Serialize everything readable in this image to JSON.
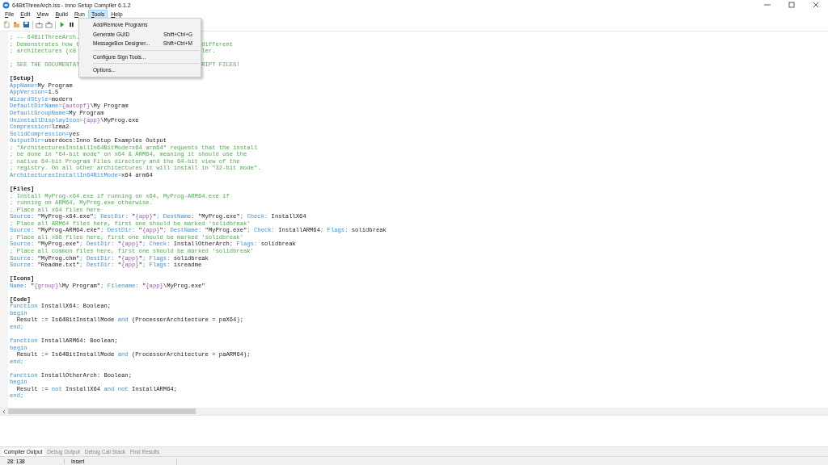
{
  "window": {
    "title": "64BitThreeArch.iss - Inno Setup Compiler 6.1.2"
  },
  "menu_bar": [
    {
      "label": "File",
      "selected": false
    },
    {
      "label": "Edit",
      "selected": false
    },
    {
      "label": "View",
      "selected": false
    },
    {
      "label": "Build",
      "selected": false
    },
    {
      "label": "Run",
      "selected": false
    },
    {
      "label": "Tools",
      "selected": true
    },
    {
      "label": "Help",
      "selected": false
    }
  ],
  "tools_menu": [
    {
      "kind": "item",
      "label": "Add/Remove Programs"
    },
    {
      "kind": "item",
      "label": "Generate GUID",
      "shortcut": "Shift+Ctrl+G"
    },
    {
      "kind": "item",
      "label": "MessageBox Designer...",
      "shortcut": "Shift+Ctrl+M"
    },
    {
      "kind": "separator"
    },
    {
      "kind": "item",
      "label": "Configure Sign Tools..."
    },
    {
      "kind": "separator"
    },
    {
      "kind": "item",
      "label": "Options..."
    }
  ],
  "editor": {
    "lines": [
      {
        "tokens": [
          {
            "kind": "comment",
            "text": "; -- 64BitThreeArch."
          }
        ]
      },
      {
        "tokens": [
          {
            "kind": "comment",
            "text": "; Demonstrates how t"
          }
        ],
        "tail": [
          {
            "kind": "comment",
            "text": "different"
          }
        ]
      },
      {
        "tokens": [
          {
            "kind": "comment",
            "text": "; architectures (x8"
          }
        ],
        "tail": [
          {
            "kind": "comment",
            "text": "ler."
          }
        ]
      },
      {
        "kind": "blank"
      },
      {
        "tokens": [
          {
            "kind": "comment",
            "text": "; SEE THE DOCUMENTAT"
          }
        ],
        "tail": [
          {
            "kind": "comment",
            "text": "RIPT FILES!"
          }
        ]
      },
      {
        "kind": "blank"
      },
      {
        "tokens": [
          {
            "kind": "section",
            "text": "[Setup]"
          }
        ]
      },
      {
        "tokens": [
          {
            "kind": "key",
            "text": "AppName="
          },
          {
            "kind": "text",
            "text": "My Program"
          }
        ]
      },
      {
        "tokens": [
          {
            "kind": "key",
            "text": "AppVersion="
          },
          {
            "kind": "text",
            "text": "1.5"
          }
        ]
      },
      {
        "tokens": [
          {
            "kind": "key",
            "text": "WizardStyle="
          },
          {
            "kind": "text",
            "text": "modern"
          }
        ]
      },
      {
        "tokens": [
          {
            "kind": "key",
            "text": "DefaultDirName="
          },
          {
            "kind": "const",
            "text": "{autopf}"
          },
          {
            "kind": "text",
            "text": "\\My Program"
          }
        ]
      },
      {
        "tokens": [
          {
            "kind": "key",
            "text": "DefaultGroupName="
          },
          {
            "kind": "text",
            "text": "My Program"
          }
        ]
      },
      {
        "tokens": [
          {
            "kind": "key",
            "text": "UninstallDisplayIcon="
          },
          {
            "kind": "const",
            "text": "{app}"
          },
          {
            "kind": "text",
            "text": "\\MyProg.exe"
          }
        ]
      },
      {
        "tokens": [
          {
            "kind": "key",
            "text": "Compression="
          },
          {
            "kind": "text",
            "text": "lzma2"
          }
        ]
      },
      {
        "tokens": [
          {
            "kind": "key",
            "text": "SolidCompression="
          },
          {
            "kind": "text",
            "text": "yes"
          }
        ]
      },
      {
        "tokens": [
          {
            "kind": "key",
            "text": "OutputDir="
          },
          {
            "kind": "text",
            "text": "userdocs:Inno Setup Examples Output"
          }
        ]
      },
      {
        "tokens": [
          {
            "kind": "comment",
            "text": "; \"ArchitecturesInstallIn64BitMode=x64 arm64\" requests that the install"
          }
        ]
      },
      {
        "tokens": [
          {
            "kind": "comment",
            "text": "; be done in \"64-bit mode\" on x64 & ARM64, meaning it should use the"
          }
        ]
      },
      {
        "tokens": [
          {
            "kind": "comment",
            "text": "; native 64-bit Program Files directory and the 64-bit view of the"
          }
        ]
      },
      {
        "tokens": [
          {
            "kind": "comment",
            "text": "; registry. On all other architectures it will install in \"32-bit mode\"."
          }
        ]
      },
      {
        "tokens": [
          {
            "kind": "key",
            "text": "ArchitecturesInstallIn64BitMode="
          },
          {
            "kind": "text",
            "text": "x64 arm64"
          }
        ]
      },
      {
        "kind": "blank"
      },
      {
        "tokens": [
          {
            "kind": "section",
            "text": "[Files]"
          }
        ]
      },
      {
        "tokens": [
          {
            "kind": "comment",
            "text": "; Install MyProg-x64.exe if running on x64, MyProg-ARM64.exe if"
          }
        ]
      },
      {
        "tokens": [
          {
            "kind": "comment",
            "text": "; running on ARM64, MyProg.exe otherwise."
          }
        ]
      },
      {
        "tokens": [
          {
            "kind": "comment",
            "text": "; Place all x64 files here"
          }
        ]
      },
      {
        "tokens": [
          {
            "kind": "key",
            "text": "Source: "
          },
          {
            "kind": "text",
            "text": "\"MyProg-x64.exe\""
          },
          {
            "kind": "key",
            "text": "; DestDir: "
          },
          {
            "kind": "text",
            "text": "\""
          },
          {
            "kind": "const",
            "text": "{app}"
          },
          {
            "kind": "text",
            "text": "\""
          },
          {
            "kind": "key",
            "text": "; DestName: "
          },
          {
            "kind": "text",
            "text": "\"MyProg.exe\""
          },
          {
            "kind": "key",
            "text": "; Check: "
          },
          {
            "kind": "text",
            "text": "InstallX64"
          }
        ]
      },
      {
        "tokens": [
          {
            "kind": "comment",
            "text": "; Place all ARM64 files here, first one should be marked 'solidbreak'"
          }
        ]
      },
      {
        "tokens": [
          {
            "kind": "key",
            "text": "Source: "
          },
          {
            "kind": "text",
            "text": "\"MyProg-ARM64.exe\""
          },
          {
            "kind": "key",
            "text": "; DestDir: "
          },
          {
            "kind": "text",
            "text": "\""
          },
          {
            "kind": "const",
            "text": "{app}"
          },
          {
            "kind": "text",
            "text": "\""
          },
          {
            "kind": "key",
            "text": "; DestName: "
          },
          {
            "kind": "text",
            "text": "\"MyProg.exe\""
          },
          {
            "kind": "key",
            "text": "; Check: "
          },
          {
            "kind": "text",
            "text": "InstallARM64"
          },
          {
            "kind": "key",
            "text": "; Flags: "
          },
          {
            "kind": "text",
            "text": "solidbreak"
          }
        ]
      },
      {
        "tokens": [
          {
            "kind": "comment",
            "text": "; Place all x86 files here, first one should be marked 'solidbreak'"
          }
        ]
      },
      {
        "tokens": [
          {
            "kind": "key",
            "text": "Source: "
          },
          {
            "kind": "text",
            "text": "\"MyProg.exe\""
          },
          {
            "kind": "key",
            "text": "; DestDir: "
          },
          {
            "kind": "text",
            "text": "\""
          },
          {
            "kind": "const",
            "text": "{app}"
          },
          {
            "kind": "text",
            "text": "\""
          },
          {
            "kind": "key",
            "text": "; Check: "
          },
          {
            "kind": "text",
            "text": "InstallOtherArch"
          },
          {
            "kind": "key",
            "text": "; Flags: "
          },
          {
            "kind": "text",
            "text": "solidbreak"
          }
        ]
      },
      {
        "tokens": [
          {
            "kind": "comment",
            "text": "; Place all common files here, first one should be marked 'solidbreak'"
          }
        ]
      },
      {
        "tokens": [
          {
            "kind": "key",
            "text": "Source: "
          },
          {
            "kind": "text",
            "text": "\"MyProg.chm\""
          },
          {
            "kind": "key",
            "text": "; DestDir: "
          },
          {
            "kind": "text",
            "text": "\""
          },
          {
            "kind": "const",
            "text": "{app}"
          },
          {
            "kind": "text",
            "text": "\""
          },
          {
            "kind": "key",
            "text": "; Flags: "
          },
          {
            "kind": "text",
            "text": "solidbreak"
          }
        ]
      },
      {
        "tokens": [
          {
            "kind": "key",
            "text": "Source: "
          },
          {
            "kind": "text",
            "text": "\"Readme.txt\""
          },
          {
            "kind": "key",
            "text": "; DestDir: "
          },
          {
            "kind": "text",
            "text": "\""
          },
          {
            "kind": "const",
            "text": "{app}"
          },
          {
            "kind": "text",
            "text": "\""
          },
          {
            "kind": "key",
            "text": "; Flags: "
          },
          {
            "kind": "text",
            "text": "isreadme"
          }
        ]
      },
      {
        "kind": "blank"
      },
      {
        "tokens": [
          {
            "kind": "section",
            "text": "[Icons]"
          }
        ]
      },
      {
        "tokens": [
          {
            "kind": "key",
            "text": "Name: "
          },
          {
            "kind": "text",
            "text": "\""
          },
          {
            "kind": "const",
            "text": "{group}"
          },
          {
            "kind": "text",
            "text": "\\My Program\""
          },
          {
            "kind": "key",
            "text": "; Filename: "
          },
          {
            "kind": "text",
            "text": "\""
          },
          {
            "kind": "const",
            "text": "{app}"
          },
          {
            "kind": "text",
            "text": "\\MyProg.exe\""
          }
        ]
      },
      {
        "kind": "blank"
      },
      {
        "tokens": [
          {
            "kind": "section",
            "text": "[Code]"
          }
        ]
      },
      {
        "tokens": [
          {
            "kind": "keyword",
            "text": "function"
          },
          {
            "kind": "text",
            "text": " InstallX64: Boolean;"
          }
        ]
      },
      {
        "tokens": [
          {
            "kind": "keyword",
            "text": "begin"
          }
        ]
      },
      {
        "tokens": [
          {
            "kind": "text",
            "text": "  Result := Is64BitInstallMode "
          },
          {
            "kind": "keyword",
            "text": "and"
          },
          {
            "kind": "text",
            "text": " (ProcessorArchitecture = paX64);"
          }
        ]
      },
      {
        "tokens": [
          {
            "kind": "keyword",
            "text": "end;"
          }
        ]
      },
      {
        "kind": "blank"
      },
      {
        "tokens": [
          {
            "kind": "keyword",
            "text": "function"
          },
          {
            "kind": "text",
            "text": " InstallARM64: Boolean;"
          }
        ]
      },
      {
        "tokens": [
          {
            "kind": "keyword",
            "text": "begin"
          }
        ]
      },
      {
        "tokens": [
          {
            "kind": "text",
            "text": "  Result := Is64BitInstallMode "
          },
          {
            "kind": "keyword",
            "text": "and"
          },
          {
            "kind": "text",
            "text": " (ProcessorArchitecture = paARM64);"
          }
        ]
      },
      {
        "tokens": [
          {
            "kind": "keyword",
            "text": "end;"
          }
        ]
      },
      {
        "kind": "blank"
      },
      {
        "tokens": [
          {
            "kind": "keyword",
            "text": "function"
          },
          {
            "kind": "text",
            "text": " InstallOtherArch: Boolean;"
          }
        ]
      },
      {
        "tokens": [
          {
            "kind": "keyword",
            "text": "begin"
          }
        ]
      },
      {
        "tokens": [
          {
            "kind": "text",
            "text": "  Result := "
          },
          {
            "kind": "keyword",
            "text": "not"
          },
          {
            "kind": "text",
            "text": " InstallX64 "
          },
          {
            "kind": "keyword",
            "text": "and not"
          },
          {
            "kind": "text",
            "text": " InstallARM64;"
          }
        ]
      },
      {
        "tokens": [
          {
            "kind": "keyword",
            "text": "end;"
          }
        ]
      }
    ]
  },
  "output_tabs": [
    {
      "label": "Compiler Output",
      "selected": true
    },
    {
      "label": "Debug Output",
      "selected": false
    },
    {
      "label": "Debug Call Stack",
      "selected": false
    },
    {
      "label": "Find Results",
      "selected": false
    }
  ],
  "status_bar": {
    "position": "28: 138",
    "mode": "Insert"
  }
}
